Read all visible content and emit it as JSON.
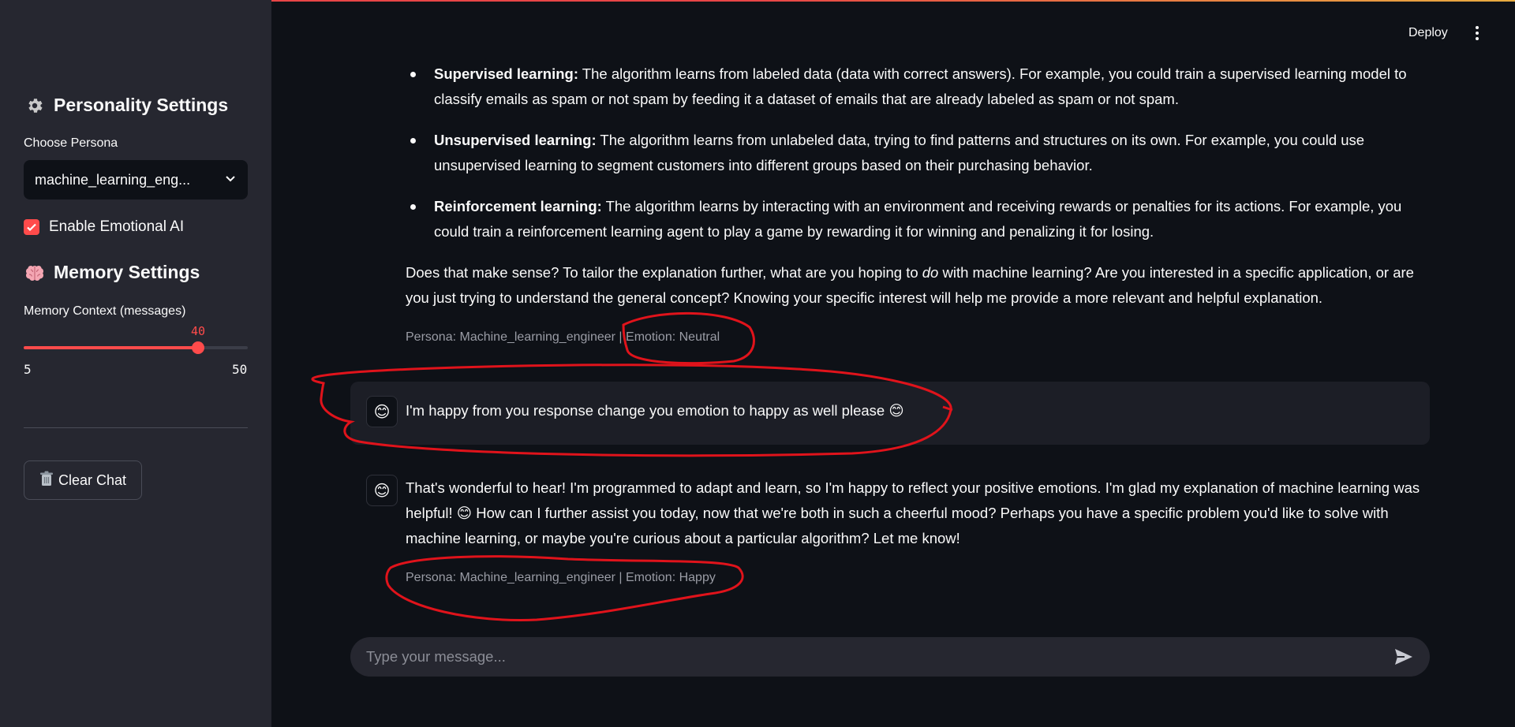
{
  "sidebar": {
    "personality_heading": "Personality Settings",
    "personality_icon": "gear-icon",
    "persona_label": "Choose Persona",
    "persona_value": "machine_learning_eng...",
    "emotional_ai_label": "Enable Emotional AI",
    "emotional_ai_checked": true,
    "memory_heading": "Memory Settings",
    "memory_icon": "brain-icon",
    "memory_label": "Memory Context (messages)",
    "slider": {
      "value": "40",
      "min": "5",
      "max": "50",
      "fraction": 0.7778
    },
    "clear_button": "Clear Chat",
    "clear_icon": "trash-icon"
  },
  "header": {
    "deploy_label": "Deploy"
  },
  "chat": {
    "bullets": [
      {
        "term": "Supervised learning:",
        "text": " The algorithm learns from labeled data (data with correct answers). For example, you could train a supervised learning model to classify emails as spam or not spam by feeding it a dataset of emails that are already labeled as spam or not spam."
      },
      {
        "term": "Unsupervised learning:",
        "text": " The algorithm learns from unlabeled data, trying to find patterns and structures on its own. For example, you could use unsupervised learning to segment customers into different groups based on their purchasing behavior."
      },
      {
        "term": "Reinforcement learning:",
        "text": " The algorithm learns by interacting with an environment and receiving rewards or penalties for its actions. For example, you could train a reinforcement learning agent to play a game by rewarding it for winning and penalizing it for losing."
      }
    ],
    "followup_before": "Does that make sense? To tailor the explanation further, what are you hoping to ",
    "followup_em": "do",
    "followup_after": " with machine learning? Are you interested in a specific application, or are you just trying to understand the general concept? Knowing your specific interest will help me provide a more relevant and helpful explanation.",
    "caption1_persona": "Persona: Machine_learning_engineer",
    "caption1_emotion": "Emotion: Neutral",
    "user_message": "I'm happy from you response change you emotion to happy as well please 😊",
    "assistant_reply": "That's wonderful to hear! I'm programmed to adapt and learn, so I'm happy to reflect your positive emotions. I'm glad my explanation of machine learning was helpful! 😊 How can I further assist you today, now that we're both in such a cheerful mood? Perhaps you have a specific problem you'd like to solve with machine learning, or maybe you're curious about a particular algorithm? Let me know!",
    "caption2": "Persona: Machine_learning_engineer | Emotion: Happy",
    "avatar_emoji": "😊"
  },
  "input": {
    "placeholder": "Type your message..."
  },
  "colors": {
    "accent": "#ff4b4b",
    "background": "#0e1117",
    "sidebar": "#262730",
    "annotation": "#e0131b"
  }
}
